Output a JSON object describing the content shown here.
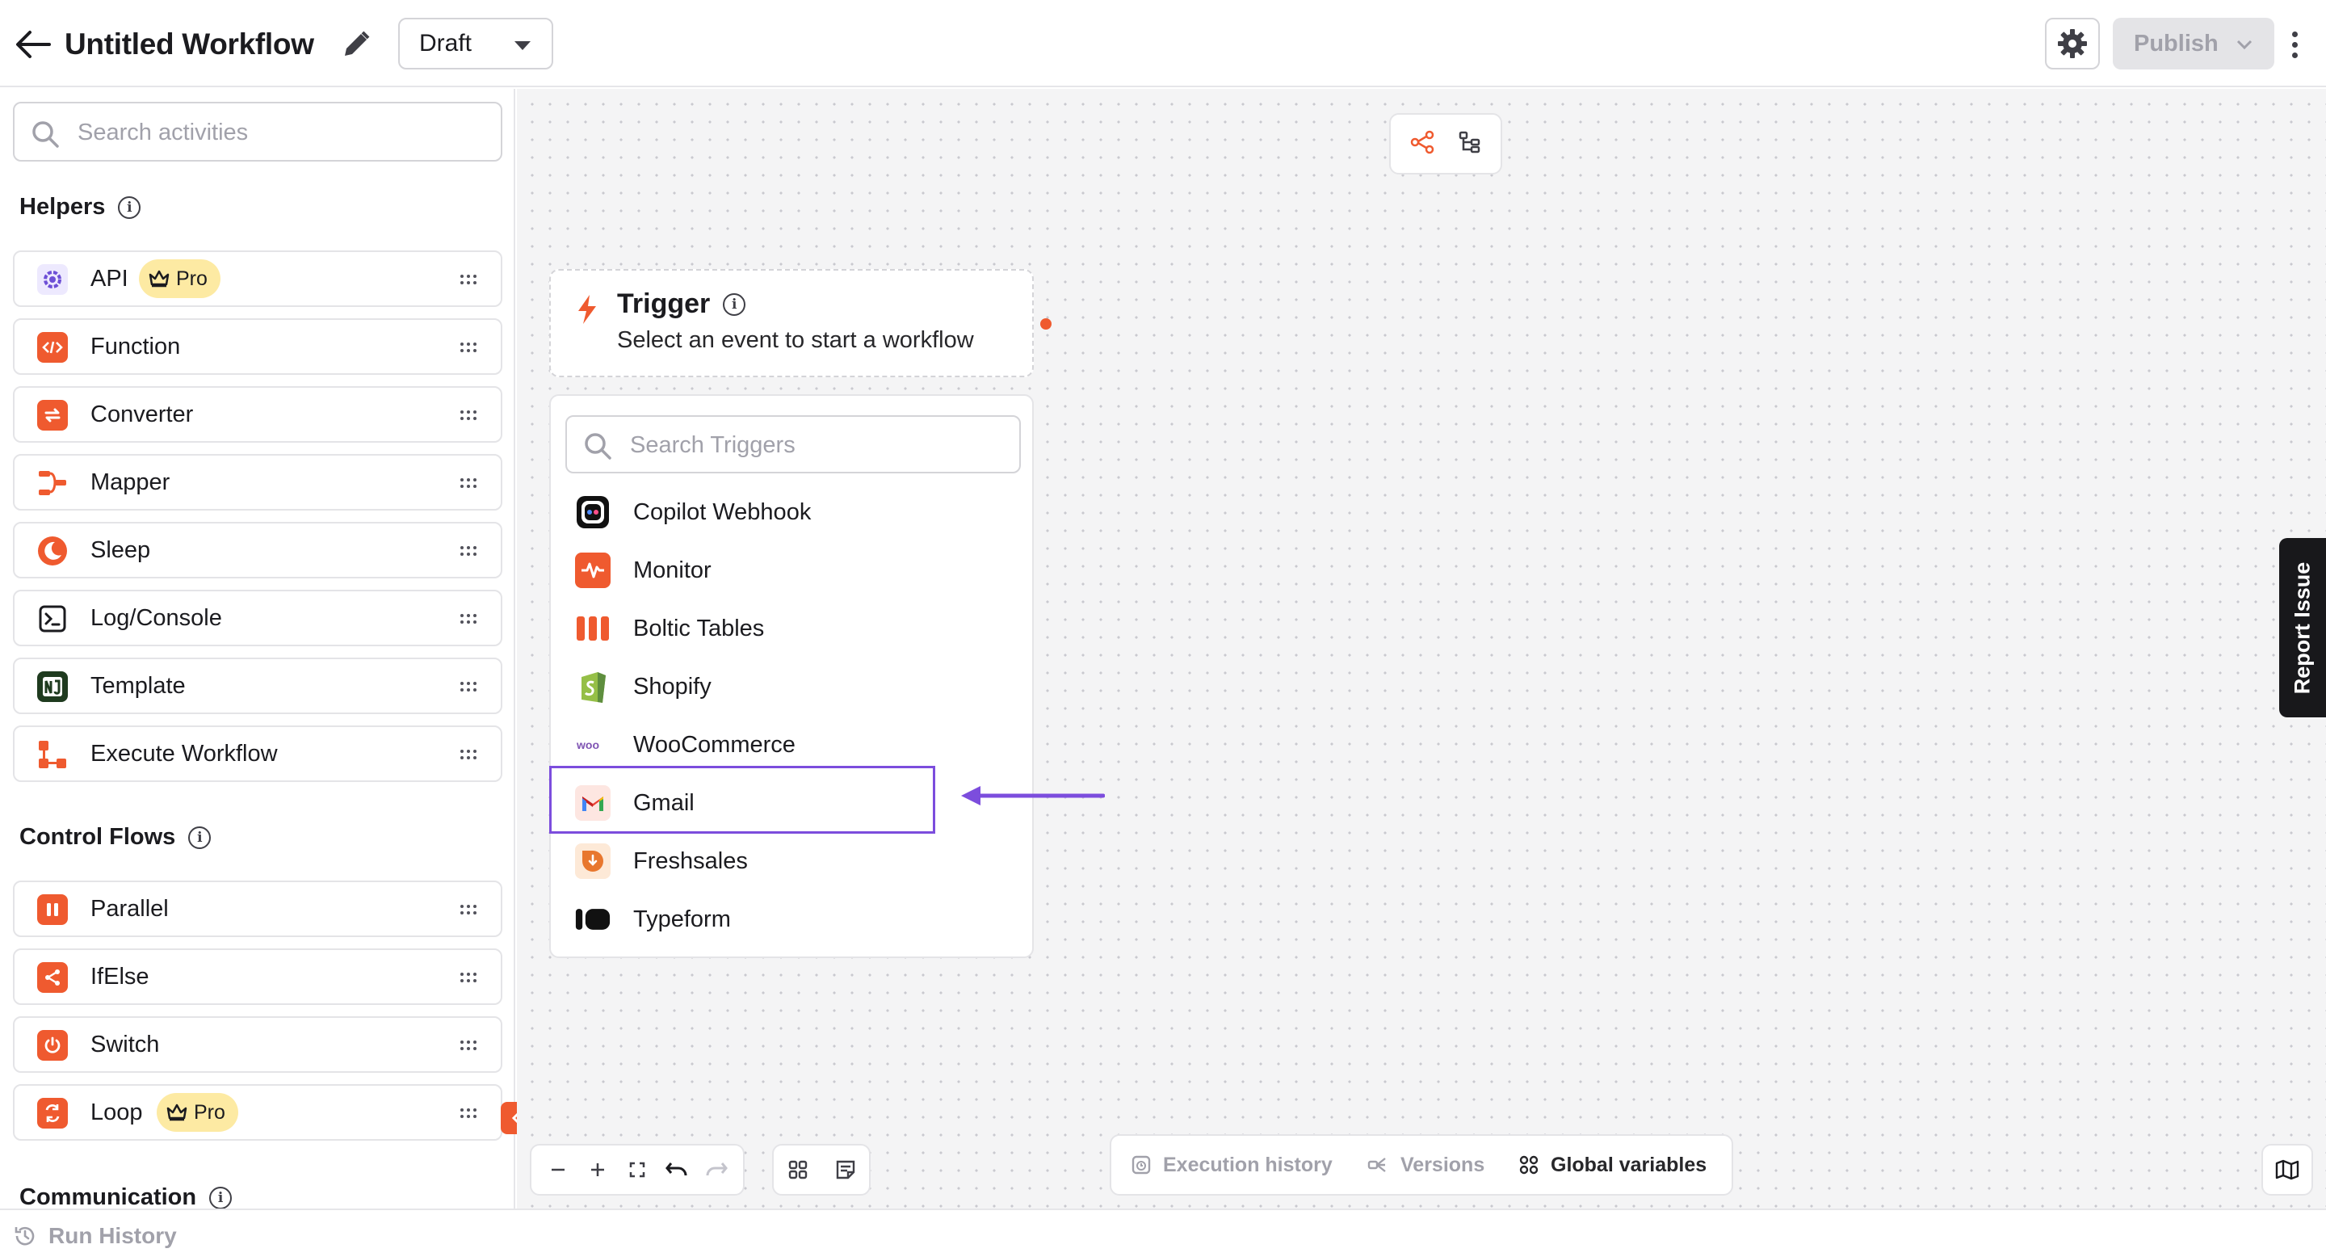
{
  "header": {
    "title": "Untitled Workflow",
    "status_select": "Draft",
    "publish_label": "Publish"
  },
  "sidebar": {
    "search_placeholder": "Search activities",
    "sections": [
      {
        "title": "Helpers",
        "items": [
          {
            "label": "API",
            "badge": "Pro",
            "icon": "api-gear-icon"
          },
          {
            "label": "Function",
            "icon": "code-icon"
          },
          {
            "label": "Converter",
            "icon": "converter-icon"
          },
          {
            "label": "Mapper",
            "icon": "mapper-icon"
          },
          {
            "label": "Sleep",
            "icon": "moon-icon"
          },
          {
            "label": "Log/Console",
            "icon": "terminal-icon"
          },
          {
            "label": "Template",
            "icon": "template-icon"
          },
          {
            "label": "Execute Workflow",
            "icon": "execute-workflow-icon"
          }
        ]
      },
      {
        "title": "Control Flows",
        "items": [
          {
            "label": "Parallel",
            "icon": "parallel-icon"
          },
          {
            "label": "IfElse",
            "icon": "branch-icon"
          },
          {
            "label": "Switch",
            "icon": "power-icon"
          },
          {
            "label": "Loop",
            "badge": "Pro",
            "icon": "loop-icon"
          }
        ]
      },
      {
        "title": "Communication",
        "items": []
      }
    ]
  },
  "trigger": {
    "title": "Trigger",
    "subtitle": "Select an event to start a workflow",
    "search_placeholder": "Search Triggers",
    "options": [
      {
        "label": "Copilot Webhook",
        "icon": "copilot-webhook-icon"
      },
      {
        "label": "Monitor",
        "icon": "monitor-pulse-icon"
      },
      {
        "label": "Boltic Tables",
        "icon": "tables-icon"
      },
      {
        "label": "Shopify",
        "icon": "shopify-icon"
      },
      {
        "label": "WooCommerce",
        "icon": "woocommerce-icon"
      },
      {
        "label": "Gmail",
        "icon": "gmail-icon",
        "highlighted": true
      },
      {
        "label": "Freshsales",
        "icon": "freshsales-icon"
      },
      {
        "label": "Typeform",
        "icon": "typeform-icon"
      }
    ]
  },
  "bottom_tabs": [
    {
      "label": "Execution history",
      "icon": "history-icon",
      "active": false
    },
    {
      "label": "Versions",
      "icon": "versions-icon",
      "active": false
    },
    {
      "label": "Global variables",
      "icon": "variables-icon",
      "active": true
    }
  ],
  "report_issue_label": "Report Issue",
  "footer": {
    "run_history_label": "Run History"
  },
  "colors": {
    "accent_orange": "#ef5a2f",
    "highlight_purple": "#7c4ddd",
    "pro_badge": "#fdeaa3"
  }
}
